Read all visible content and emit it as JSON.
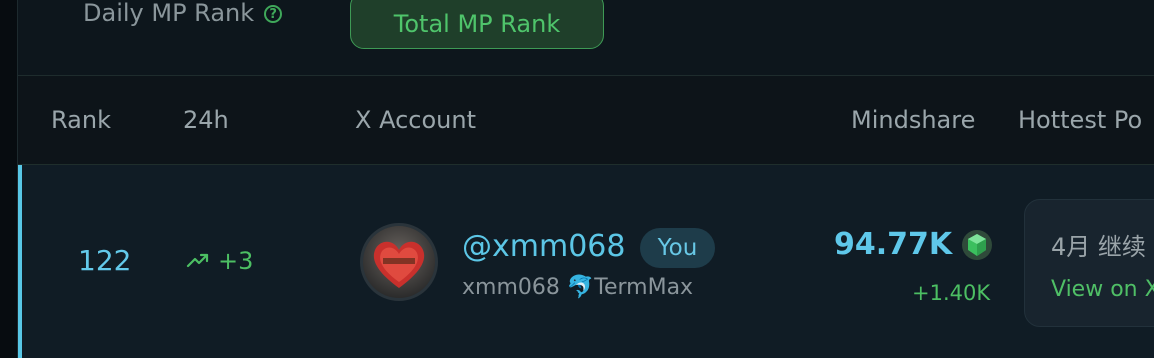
{
  "tabs": {
    "daily_label": "Daily MP Rank",
    "total_label": "Total MP Rank"
  },
  "table": {
    "columns": [
      "Rank",
      "24h",
      "X Account",
      "Mindshare",
      "Hottest Po"
    ]
  },
  "row": {
    "rank": "122",
    "change_24h": "+3",
    "handle": "@xmm068",
    "you_badge": "You",
    "display_name": "xmm068 🐬TermMax",
    "mindshare": "94.77K",
    "mindshare_change": "+1.40K",
    "hottest_post_title": "4月 继续",
    "hottest_post_link": "View on X"
  },
  "colors": {
    "accent_blue": "#5fc8ea",
    "accent_green": "#4cbf63",
    "background": "#0c1319"
  },
  "icons": {
    "help": "question-circle-icon",
    "trend": "trending-up-icon",
    "gem": "green-gem-icon"
  }
}
